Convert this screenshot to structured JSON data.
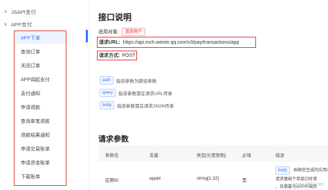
{
  "sidebar": {
    "sections": [
      {
        "label": "JSAPI支付",
        "arrow": ">"
      },
      {
        "label": "APP支付",
        "arrow": "v"
      }
    ],
    "items": [
      {
        "label": "APP下单",
        "active": true
      },
      {
        "label": "查询订单"
      },
      {
        "label": "关闭订单"
      },
      {
        "label": "APP调起支付"
      },
      {
        "label": "支付通知"
      },
      {
        "label": "申请退款"
      },
      {
        "label": "查询单笔退款"
      },
      {
        "label": "退款结果通知"
      },
      {
        "label": "申请交易账单"
      },
      {
        "label": "申请资金账单"
      },
      {
        "label": "下载账单"
      }
    ]
  },
  "main": {
    "title": "接口说明",
    "applicable_label": "适用对象:",
    "applicable_value": "直连商户",
    "url_label": "请求URL:",
    "url_value": "https://api.mch.weixin.qq.com/v3/pay/transactions/app",
    "method_label": "请求方式:",
    "method_value": "POST",
    "params": [
      {
        "tag": "path",
        "text": "指该参数为路径参数"
      },
      {
        "tag": "query",
        "text": "指该参数需在请求URL传参"
      },
      {
        "tag": "body",
        "text": "指该参数需在请求JSON传参"
      }
    ],
    "section2_title": "请求参数",
    "table": {
      "headers": [
        "参数名",
        "变量",
        "类型[长度限制]",
        "必填",
        "描述"
      ],
      "row": {
        "name": "应用ID",
        "var": "appid",
        "type": "string[1,32]",
        "required": "是",
        "desc_tag": "body",
        "desc_lines": [
          "由微信生成的应用ID",
          "请求基础下单接口时请",
          "，且需要与APP中调用"
        ]
      }
    },
    "watermark": "www.9969.net"
  },
  "colors": {
    "accent": "#2f77ff",
    "highlight_red": "#e23b36"
  }
}
